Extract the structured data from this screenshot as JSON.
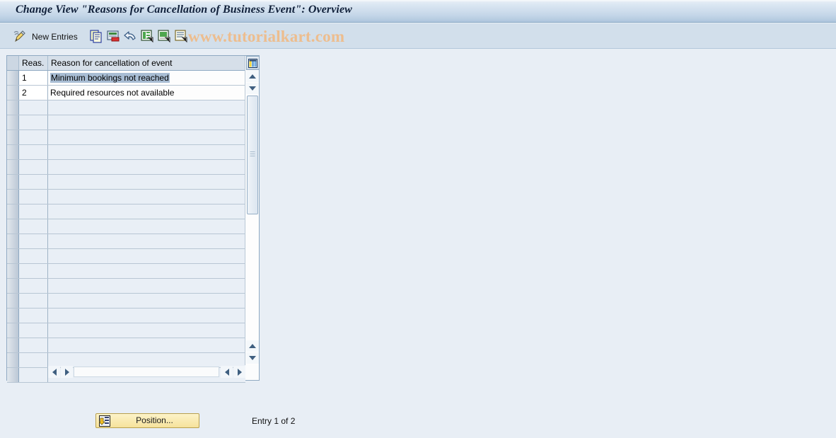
{
  "window": {
    "title": "Change View \"Reasons for Cancellation of Business Event\": Overview",
    "background_color": "#e8eef5"
  },
  "toolbar": {
    "new_entries_label": "New Entries",
    "watermark": "www.tutorialkart.com",
    "watermark_color": "#edbd8e",
    "icons": [
      {
        "name": "display-change-pencil-icon",
        "title": "Display/Change"
      },
      {
        "name": "copy-as-icon",
        "title": "Copy As..."
      },
      {
        "name": "delete-row-icon",
        "title": "Delete"
      },
      {
        "name": "undo-icon",
        "title": "Undo Change"
      },
      {
        "name": "select-all-icon",
        "title": "Select All"
      },
      {
        "name": "deselect-all-icon",
        "title": "Deselect All"
      },
      {
        "name": "details-icon",
        "title": "Details"
      }
    ]
  },
  "table": {
    "columns": [
      {
        "key": "reason_code",
        "header": "Reas."
      },
      {
        "key": "reason_text",
        "header": "Reason for cancellation of event"
      }
    ],
    "select_all_icon": "table-settings-icon",
    "rows": [
      {
        "reason_code": "1",
        "reason_text": "Minimum bookings not reached",
        "selected": true
      },
      {
        "reason_code": "2",
        "reason_text": "Required resources not available",
        "selected": false
      }
    ],
    "blank_row_count": 19,
    "scroll": {
      "vertical_thumb_top_pct": 12,
      "vertical_thumb_height_pct": 40,
      "horizontal_thumb": "full"
    }
  },
  "footer": {
    "position_button_label": "Position...",
    "position_button_icon": "position-icon",
    "entry_status": "Entry 1 of 2"
  }
}
